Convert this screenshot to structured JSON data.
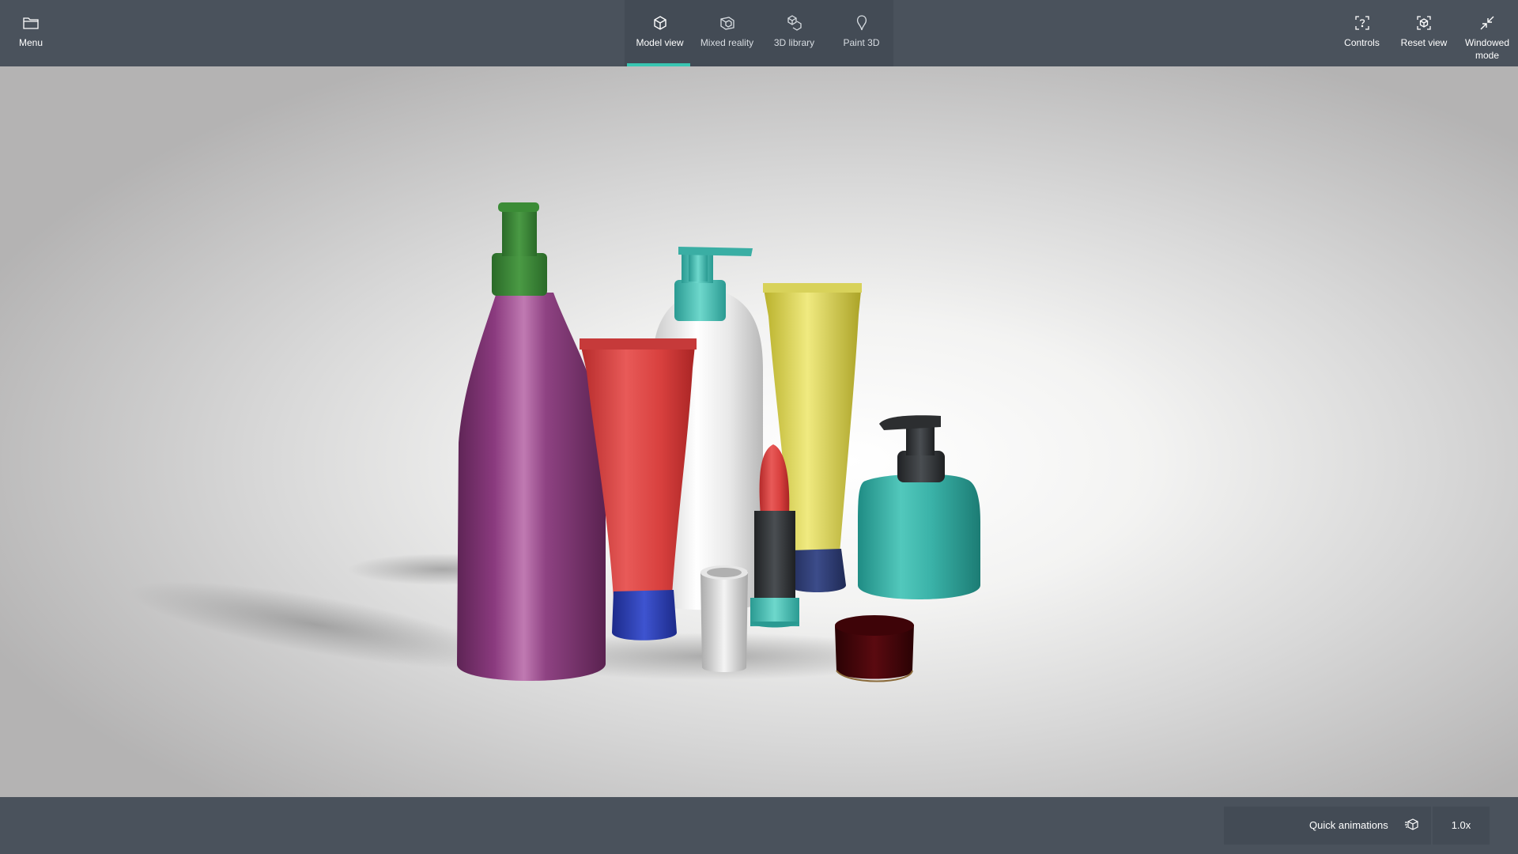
{
  "topbar": {
    "menu_label": "Menu",
    "tabs": [
      {
        "label": "Model view",
        "icon": "cube-icon",
        "active": true
      },
      {
        "label": "Mixed reality",
        "icon": "mixed-reality-icon",
        "active": false
      },
      {
        "label": "3D library",
        "icon": "3d-library-icon",
        "active": false
      },
      {
        "label": "Paint 3D",
        "icon": "paint-3d-icon",
        "active": false
      }
    ],
    "controls_label": "Controls",
    "reset_label": "Reset view",
    "windowed_label": "Windowed\nmode"
  },
  "bottombar": {
    "animations_label": "Quick animations",
    "speed_label": "1.0x"
  },
  "colors": {
    "accent": "#39c6b2",
    "bar_bg": "#4a525c",
    "group_bg": "#434b55"
  }
}
